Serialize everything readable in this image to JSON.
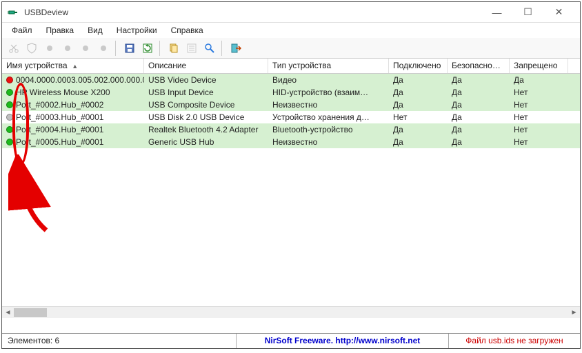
{
  "window": {
    "title": "USBDeview"
  },
  "win_controls": {
    "min": "—",
    "max": "☐",
    "close": "✕"
  },
  "menu": {
    "file": "Файл",
    "edit": "Правка",
    "view": "Вид",
    "settings": "Настройки",
    "help": "Справка"
  },
  "columns": {
    "c0": "Имя устройства",
    "sort_glyph": "▲",
    "c1": "Описание",
    "c2": "Тип устройства",
    "c3": "Подключено",
    "c4": "Безопасное …",
    "c5": "Запрещено"
  },
  "rows": [
    {
      "status": "red",
      "bg": "green",
      "name": "0004.0000.0003.005.002.000.000.0…",
      "desc": "USB Video Device",
      "type": "Видео",
      "conn": "Да",
      "safe": "Да",
      "deny": "Да"
    },
    {
      "status": "green",
      "bg": "green",
      "name": "HP Wireless Mouse X200",
      "desc": "USB Input Device",
      "type": "HID-устройство (взаим…",
      "conn": "Да",
      "safe": "Да",
      "deny": "Нет"
    },
    {
      "status": "green",
      "bg": "green",
      "name": "Port_#0002.Hub_#0002",
      "desc": "USB Composite Device",
      "type": "Неизвестно",
      "conn": "Да",
      "safe": "Да",
      "deny": "Нет"
    },
    {
      "status": "gray",
      "bg": "white",
      "name": "Port_#0003.Hub_#0001",
      "desc": "USB Disk 2.0 USB Device",
      "type": "Устройство хранения д…",
      "conn": "Нет",
      "safe": "Да",
      "deny": "Нет"
    },
    {
      "status": "green",
      "bg": "green",
      "name": "Port_#0004.Hub_#0001",
      "desc": "Realtek Bluetooth 4.2 Adapter",
      "type": "Bluetooth-устройство",
      "conn": "Да",
      "safe": "Да",
      "deny": "Нет"
    },
    {
      "status": "green",
      "bg": "green",
      "name": "Port_#0005.Hub_#0001",
      "desc": "Generic USB Hub",
      "type": "Неизвестно",
      "conn": "Да",
      "safe": "Да",
      "deny": "Нет"
    }
  ],
  "statusbar": {
    "count": "Элементов: 6",
    "link": "NirSoft Freeware.  http://www.nirsoft.net",
    "ids": "Файл usb.ids не загружен"
  }
}
